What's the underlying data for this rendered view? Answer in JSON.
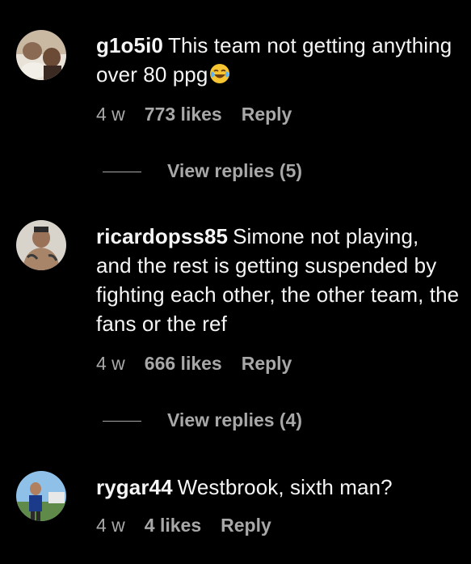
{
  "comments": [
    {
      "username": "g1o5i0",
      "text": "This team not getting anything over 80 ppg",
      "emoji": "😂",
      "age": "4 w",
      "likes": "773 likes",
      "reply": "Reply",
      "view_replies": "View replies (5)"
    },
    {
      "username": "ricardopss85",
      "text": "Simone not playing, and the rest is getting suspended by fighting each other, the other team, the fans or the ref",
      "age": "4 w",
      "likes": "666 likes",
      "reply": "Reply",
      "view_replies": "View replies (4)"
    },
    {
      "username": "rygar44",
      "text": "Westbrook, sixth man?",
      "age": "4 w",
      "likes": "4 likes",
      "reply": "Reply"
    }
  ],
  "colors": {
    "background": "#000000",
    "primary_text": "#f5f5f5",
    "secondary_text": "#a8a8a8"
  }
}
